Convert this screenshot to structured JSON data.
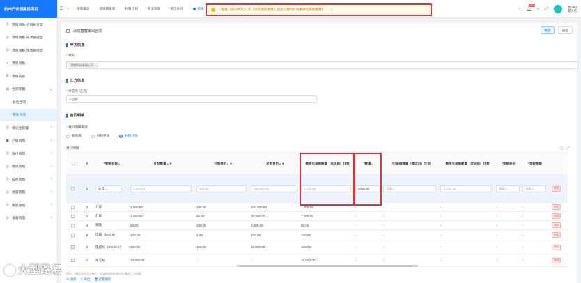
{
  "sidebar": {
    "brand": "杭州产业园建设项目",
    "items": [
      {
        "icon": "◎",
        "label": "项目看板-合同执行型",
        "arrow": ""
      },
      {
        "icon": "◎",
        "label": "项目看板-成本管控型",
        "arrow": ""
      },
      {
        "icon": "◎",
        "label": "项目看板-现场管控型",
        "arrow": ""
      },
      {
        "icon": "▪",
        "label": "项目看板",
        "arrow": ""
      },
      {
        "icon": "♙",
        "label": "项目成员",
        "arrow": ""
      },
      {
        "icon": "▤",
        "label": "合同管理",
        "arrow": "⌄"
      },
      {
        "icon": "",
        "label": "总包合同",
        "arrow": "",
        "sub": true
      },
      {
        "icon": "",
        "label": "支出合同",
        "arrow": "",
        "sub": true,
        "active": true
      },
      {
        "icon": "◎",
        "label": "保证金管理",
        "arrow": "›"
      },
      {
        "icon": "▣",
        "label": "产值管理",
        "arrow": "›"
      },
      {
        "icon": "◎",
        "label": "收付管理",
        "arrow": "›"
      },
      {
        "icon": "◎",
        "label": "物资管理",
        "arrow": "›"
      },
      {
        "icon": "◎",
        "label": "成本管理",
        "arrow": "›"
      },
      {
        "icon": "◎",
        "label": "进度管理",
        "arrow": "›"
      },
      {
        "icon": "◎",
        "label": "质量管理",
        "arrow": "›"
      },
      {
        "icon": "◎",
        "label": "设备管理",
        "arrow": "›"
      }
    ],
    "watermark": "大型路易"
  },
  "topbar": {
    "tabs": [
      "项目概览",
      "项目物资库",
      "材料计划",
      "支出管理",
      "支出合同",
      "新增"
    ],
    "alert": "『电线（BV4平方）』的【本次采购数量】超过【材料计划剩余可采购数量】",
    "badge": "99+",
    "user_name": "加odfd",
    "user_sub": "新时代"
  },
  "page": {
    "title": "添加直营支出合同",
    "confirm": "确定",
    "back": "返回",
    "party_a_section": "甲方信息",
    "party_a_label": "甲方",
    "party_a_tag": "都都科技有限公司",
    "party_b_section": "乙方信息",
    "party_b_label": "供应商 (乙方)",
    "party_b_placeholder": "选择",
    "detail_section": "合同明细",
    "source_label": "材料明细来源",
    "sources": [
      "物资库",
      "材料申请",
      "材料计划"
    ],
    "material_label": "材料明细",
    "bottom_note": "提示：材料可以对比单价，添加的材料价格对比最近三次采购",
    "add_label": "添加",
    "import_label": "导出",
    "batch_label": "批量删除"
  },
  "table": {
    "headers": [
      "#",
      "*物资名称",
      "计划数量",
      "计划单价",
      "计划合价",
      "剩余可采购数量（本次前）计划",
      "*数量",
      "*已采购数量（本次后）计划",
      "剩余可采购数量（本次后）计划",
      "*含税单价",
      "*含税金额"
    ],
    "first_row": {
      "index": "1",
      "name": "电...",
      "plan_qty": "1,000.00",
      "plan_price": "100.00",
      "plan_total": "100,000.00",
      "remain": "1,000.00",
      "qty": "2000.00",
      "purchased_placeholder": "请输入",
      "remain_after": "-1,000.00",
      "price_placeholder": "请输入",
      "amount_placeholder": "请输入",
      "delete": "删除"
    },
    "rows": [
      {
        "index": "2",
        "name": "灯盘",
        "plan_qty": "1,000.00",
        "plan_price": "100.00",
        "plan_total": "100,000.00",
        "remain": "1,000.00"
      },
      {
        "index": "3",
        "name": "灯盘",
        "plan_qty": "1,000.00",
        "plan_price": "50.00",
        "plan_total": "50,000.00",
        "remain": "1,000.00"
      },
      {
        "index": "4",
        "name": "钢筋",
        "plan_qty": "50.00",
        "plan_price": "100.00",
        "plan_total": "5,000.00",
        "remain": "50.00"
      },
      {
        "index": "5",
        "name": "电线（BV2.5）",
        "plan_qty": "100.00",
        "plan_price": "1.00",
        "plan_total": "100.00",
        "remain": "100.00"
      },
      {
        "index": "6",
        "name": "电缆线（3*2.5+2）",
        "plan_qty": "100.00",
        "plan_price": "100.00",
        "plan_total": "10,000.00",
        "remain": "100.00"
      },
      {
        "index": "7",
        "name": "单芯线",
        "plan_qty": "10,000.00",
        "plan_price": "-",
        "plan_total": "-",
        "remain": "10,000.00"
      }
    ],
    "dash": "-",
    "delete": "删除"
  }
}
